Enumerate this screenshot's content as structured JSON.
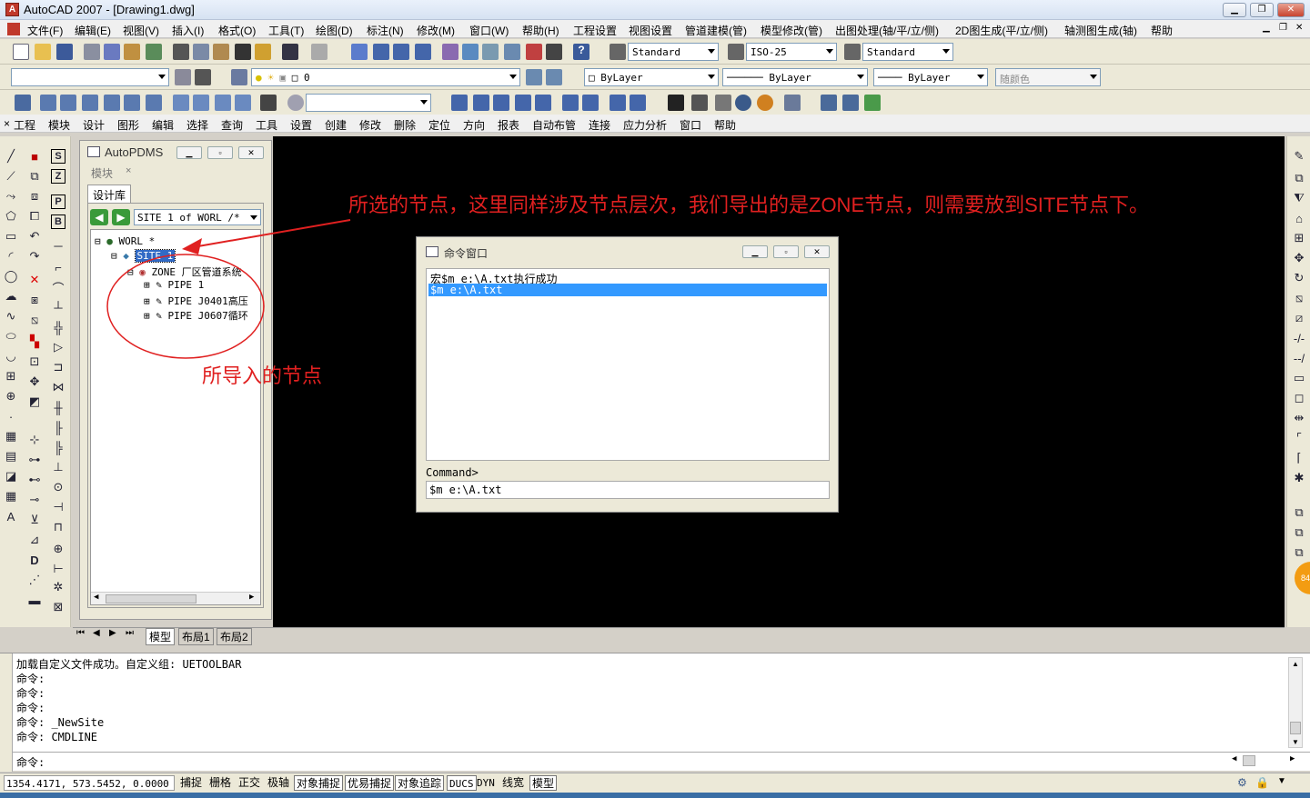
{
  "window": {
    "title": "AutoCAD 2007 - [Drawing1.dwg]",
    "app_icon": "A"
  },
  "menubar": [
    "文件(F)",
    "编辑(E)",
    "视图(V)",
    "插入(I)",
    "格式(O)",
    "工具(T)",
    "绘图(D)",
    "标注(N)",
    "修改(M)",
    "窗口(W)",
    "帮助(H)",
    "工程设置",
    "视图设置",
    "管道建模(管)",
    "模型修改(管)",
    "出图处理(轴/平/立/侧)",
    "2D图生成(平/立/侧)",
    "轴测图生成(轴)",
    "帮助"
  ],
  "styles": {
    "text_style": "Standard",
    "dim_style": "ISO-25",
    "table_style": "Standard"
  },
  "layers": {
    "current": "0",
    "color": "ByLayer",
    "linetype": "ByLayer",
    "lineweight": "ByLayer",
    "plot": "随颜色"
  },
  "menubar2": [
    "工程",
    "模块",
    "设计",
    "图形",
    "编辑",
    "选择",
    "查询",
    "工具",
    "设置",
    "创建",
    "修改",
    "删除",
    "定位",
    "方向",
    "报表",
    "自动布管",
    "连接",
    "应力分析",
    "窗口",
    "帮助"
  ],
  "panel": {
    "title": "AutoPDMS",
    "section": "模块",
    "tab": "设计库",
    "path_combo": "SITE 1 of WORL /*",
    "tree": [
      {
        "label": "WORL *",
        "level": 0
      },
      {
        "label": "SITE 1",
        "level": 1,
        "selected": true
      },
      {
        "label": "ZONE 厂区管道系统",
        "level": 2
      },
      {
        "label": "PIPE 1",
        "level": 3
      },
      {
        "label": "PIPE J0401高压",
        "level": 3
      },
      {
        "label": "PIPE J0607循环",
        "level": 3
      }
    ]
  },
  "dialog": {
    "title": "命令窗口",
    "lines": [
      "宏$m e:\\A.txt执行成功",
      "$m e:\\A.txt"
    ],
    "prompt": "Command>",
    "input": "$m e:\\A.txt"
  },
  "annotations": {
    "top": "所选的节点，这里同样涉及节点层次，我们导出的是ZONE节点，则需要放到SITE节点下。",
    "circle": "所导入的节点"
  },
  "layout_tabs": [
    "模型",
    "布局1",
    "布局2"
  ],
  "command_history": [
    "加载自定义文件成功。自定义组: UETOOLBAR",
    "命令:",
    "命令:",
    "命令:",
    "命令: _NewSite",
    "命令: CMDLINE"
  ],
  "command_prompt": "命令:",
  "status": {
    "coords": "1354.4171, 573.5452, 0.0000",
    "toggles": [
      "捕捉",
      "栅格",
      "正交",
      "极轴",
      "对象捕捉",
      "优易捕捉",
      "对象追踪",
      "DUCS",
      "DYN",
      "线宽",
      "模型"
    ]
  }
}
